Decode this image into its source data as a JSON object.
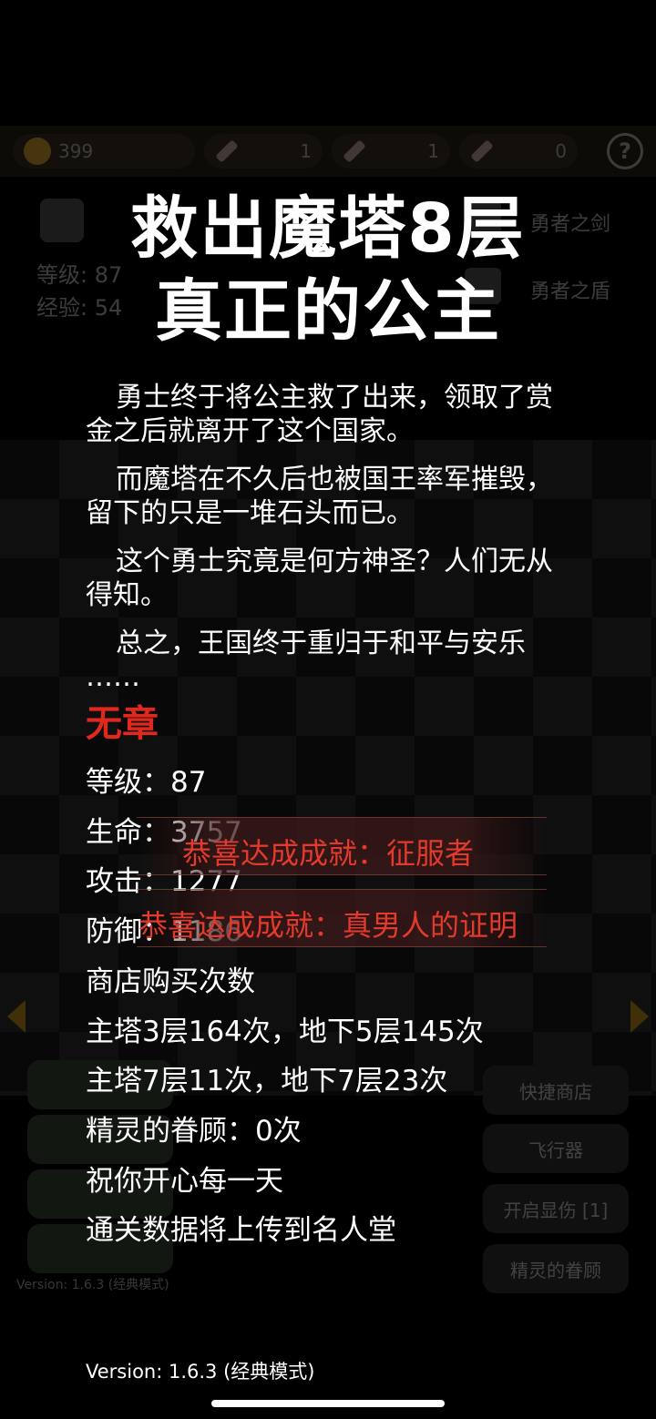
{
  "background": {
    "gold": "399",
    "keys": [
      "1",
      "1",
      "0"
    ],
    "help_label": "?",
    "hero": {
      "level_label": "等级: 87",
      "exp_label": "经验: 54"
    },
    "equipment": [
      "勇者之剑",
      "勇者之盾"
    ],
    "right_buttons": [
      "快捷商店",
      "飞行器",
      "开启显伤 [1]",
      "精灵的眷顾"
    ],
    "version": "Version: 1.6.3 (经典模式)"
  },
  "ending": {
    "title_line1": "救出魔塔8层",
    "title_line2": "真正的公主",
    "story": [
      "勇士终于将公主救了出来，领取了赏金之后就离开了这个国家。",
      "而魔塔在不久后也被国王率军摧毁，留下的只是一堆石头而已。",
      "这个勇士究竟是何方神圣？人们无从得知。",
      "总之，王国终于重归于和平与安乐"
    ],
    "story_ellipsis": "……",
    "rank": "无章",
    "stats": [
      "等级：87",
      "生命：3757",
      "攻击：1277",
      "防御：1186",
      "商店购买次数",
      "主塔3层164次，地下5层145次",
      "主塔7层11次，地下7层23次",
      "精灵的眷顾：0次",
      "祝你开心每一天",
      "通关数据将上传到名人堂"
    ]
  },
  "achievements": [
    "恭喜达成成就：征服者",
    "恭喜达成成就：真男人的证明"
  ],
  "version": "Version: 1.6.3 (经典模式)",
  "colors": {
    "rank": "#e0281e",
    "achievement": "#e23a2c",
    "background": "#000000"
  }
}
